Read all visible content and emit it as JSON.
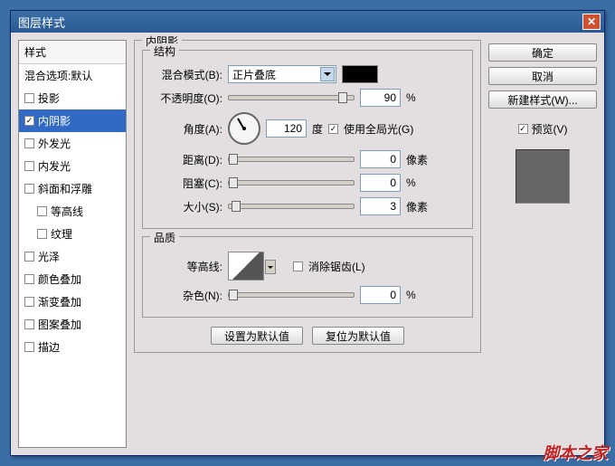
{
  "title": "图层样式",
  "sidebar": {
    "header": "样式",
    "blend_options": "混合选项:默认",
    "items": [
      {
        "label": "投影",
        "checked": false
      },
      {
        "label": "内阴影",
        "checked": true,
        "selected": true
      },
      {
        "label": "外发光",
        "checked": false
      },
      {
        "label": "内发光",
        "checked": false
      },
      {
        "label": "斜面和浮雕",
        "checked": false
      },
      {
        "label": "等高线",
        "checked": false,
        "indent": true
      },
      {
        "label": "纹理",
        "checked": false,
        "indent": true
      },
      {
        "label": "光泽",
        "checked": false
      },
      {
        "label": "颜色叠加",
        "checked": false
      },
      {
        "label": "渐变叠加",
        "checked": false
      },
      {
        "label": "图案叠加",
        "checked": false
      },
      {
        "label": "描边",
        "checked": false
      }
    ]
  },
  "main": {
    "group_title": "内阴影",
    "structure": {
      "legend": "结构",
      "blend_mode_label": "混合模式(B):",
      "blend_mode_value": "正片叠底",
      "opacity_label": "不透明度(O):",
      "opacity_value": "90",
      "opacity_unit": "%",
      "angle_label": "角度(A):",
      "angle_value": "120",
      "angle_unit": "度",
      "global_light_label": "使用全局光(G)",
      "distance_label": "距离(D):",
      "distance_value": "0",
      "distance_unit": "像素",
      "choke_label": "阻塞(C):",
      "choke_value": "0",
      "choke_unit": "%",
      "size_label": "大小(S):",
      "size_value": "3",
      "size_unit": "像素"
    },
    "quality": {
      "legend": "品质",
      "contour_label": "等高线:",
      "antialias_label": "消除锯齿(L)",
      "noise_label": "杂色(N):",
      "noise_value": "0",
      "noise_unit": "%"
    },
    "buttons": {
      "make_default": "设置为默认值",
      "reset_default": "复位为默认值"
    }
  },
  "right": {
    "ok": "确定",
    "cancel": "取消",
    "new_style": "新建样式(W)...",
    "preview_label": "预览(V)"
  },
  "watermark": "脚本之家"
}
